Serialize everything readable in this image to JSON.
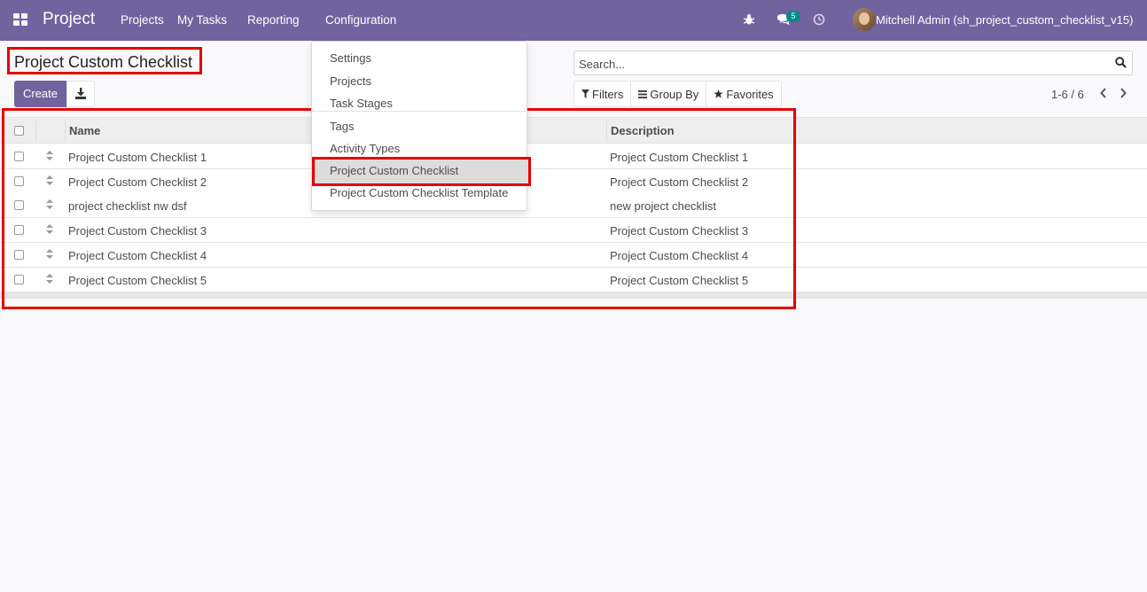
{
  "navbar": {
    "app_name": "Project",
    "menus": [
      "Projects",
      "My Tasks",
      "Reporting",
      "Configuration"
    ],
    "messages_count": "5",
    "user_name": "Mitchell Admin (sh_project_custom_checklist_v15)",
    "bg_color": "#71639e"
  },
  "control": {
    "title": "Project Custom Checklist",
    "create_label": "Create",
    "search_placeholder": "Search...",
    "filters_label": "Filters",
    "groupby_label": "Group By",
    "favorites_label": "Favorites",
    "pager": "1-6 / 6"
  },
  "table": {
    "headers": [
      "Name",
      "Description"
    ],
    "rows": [
      [
        "Project Custom Checklist 1",
        "Project Custom Checklist 1"
      ],
      [
        "Project Custom Checklist 2",
        "Project Custom Checklist 2"
      ],
      [
        "project checklist nw dsf",
        "new project checklist"
      ],
      [
        "Project Custom Checklist 3",
        "Project Custom Checklist 3"
      ],
      [
        "Project Custom Checklist 4",
        "Project Custom Checklist 4"
      ],
      [
        "Project Custom Checklist 5",
        "Project Custom Checklist 5"
      ]
    ]
  },
  "dropdown": {
    "items": [
      "Settings",
      "Projects",
      "Task Stages",
      "Tags",
      "Activity Types",
      "Project Custom Checklist",
      "Project Custom Checklist Template"
    ],
    "active": "Project Custom Checklist"
  },
  "colors": {
    "highlight": "#e50000",
    "primary": "#71639e"
  }
}
